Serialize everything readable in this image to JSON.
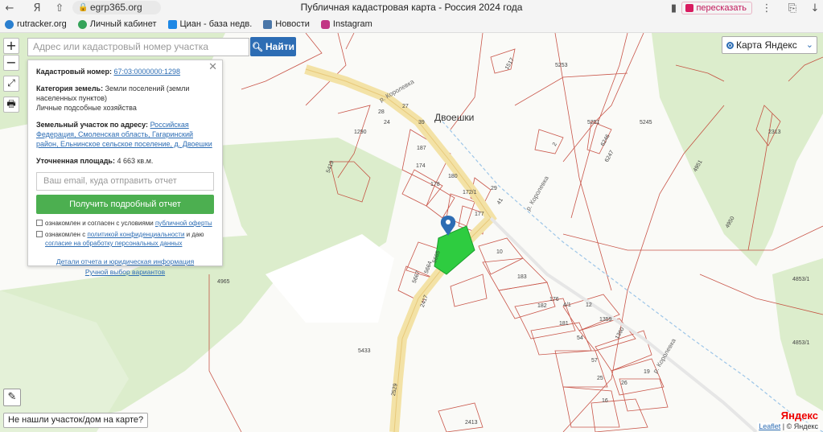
{
  "browser": {
    "back": "←",
    "url": "egrp365.org",
    "page_title": "Публичная кадастровая карта - Россия 2024 года",
    "retell": "пересказать",
    "bookmarks": [
      {
        "label": "rutracker.org",
        "color": "#2a7fcf"
      },
      {
        "label": "Личный кабинет",
        "color": "#36a35a"
      },
      {
        "label": "Циан - база недв.",
        "color": "#1e88e5"
      },
      {
        "label": "Новости",
        "color": "#4a76a8"
      },
      {
        "label": "Instagram",
        "color": "#c13584"
      }
    ]
  },
  "map_controls": {
    "zoom_in": "+",
    "zoom_out": "−",
    "fullscreen": "⤢",
    "print": "🖶",
    "measure": "✎"
  },
  "search": {
    "placeholder": "Адрес или кадастровый номер участка",
    "button_label": "Найти"
  },
  "layer": {
    "selected": "Карта Яндекс"
  },
  "info_panel": {
    "cad_number_label": "Кадастровый номер:",
    "cad_number_value": "67:03:0000000:1298",
    "category_label": "Категория земель:",
    "category_value": "Земли поселений (земли населенных пунктов)",
    "use_value": "Личные подсобные хозяйства",
    "address_label": "Земельный участок по адресу:",
    "address_value": "Российская Федерация, Смоленская область, Гагаринский район, Ельнинское сельское поселение, д. Двоешки",
    "area_label": "Уточненная площадь:",
    "area_value": "4 663 кв.м.",
    "email_placeholder": "Ваш email, куда отправить отчет",
    "report_button": "Получить подробный отчет",
    "consent1_text": "ознакомлен и согласен с условиями",
    "consent1_link": "публичной оферты",
    "consent2_text": "ознакомлен с",
    "consent2_link": "политикой конфиденциальности",
    "consent2_and": "и даю",
    "consent2_link2": "согласие на обработку персональных данных",
    "details_link": "Детали отчета и юридическая информация",
    "manual_link": "Ручной выбор вариантов"
  },
  "map_labels": {
    "village": "Двоешки",
    "road_name": "р. Королевка",
    "parcels": [
      "5253",
      "5245",
      "5251",
      "4951",
      "4950",
      "4853/1",
      "4853/1",
      "5419",
      "4965",
      "5433",
      "2417",
      "2529",
      "2413",
      "1290",
      "24",
      "27",
      "28",
      "39",
      "187",
      "174",
      "180",
      "178",
      "172/1",
      "29",
      "41",
      "177",
      "10",
      "183",
      "182",
      "176",
      "4/1",
      "12",
      "1359",
      "1360",
      "181",
      "54",
      "57",
      "25",
      "16",
      "26",
      "19",
      "5665",
      "5664",
      "5667",
      "2",
      "6246",
      "6247",
      "2313",
      "1517"
    ]
  },
  "footer": {
    "not_found": "Не нашли участок/дом на карте?",
    "attribution_link": "Leaflet",
    "attribution_rest": "| © Яндекс",
    "yandex_logo_red": "Я",
    "yandex_logo_rest": "ндекс"
  },
  "colors": {
    "accent": "#2d6db4",
    "green_button": "#4caf50",
    "selected_parcel": "#2ecc40",
    "forest": "#d8ecc8",
    "road": "#f3e2a6",
    "parcel_line": "#c0392b"
  }
}
